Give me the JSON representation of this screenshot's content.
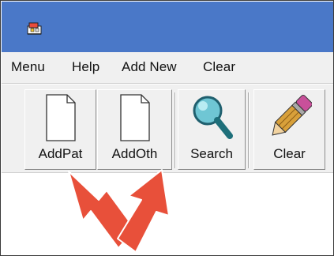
{
  "window": {
    "app_icon": "app-icon",
    "title_color": "#4a78c8"
  },
  "menubar": {
    "items": [
      "Menu",
      "Help",
      "Add New",
      "Clear"
    ]
  },
  "toolbar": {
    "buttons": [
      {
        "label": "AddPat",
        "icon": "document-icon"
      },
      {
        "label": "AddOth",
        "icon": "document-icon"
      },
      {
        "label": "Search",
        "icon": "magnifier-icon"
      },
      {
        "label": "Clear",
        "icon": "eraser-icon"
      }
    ]
  },
  "annotation": {
    "arrow_color": "#e8503a"
  }
}
